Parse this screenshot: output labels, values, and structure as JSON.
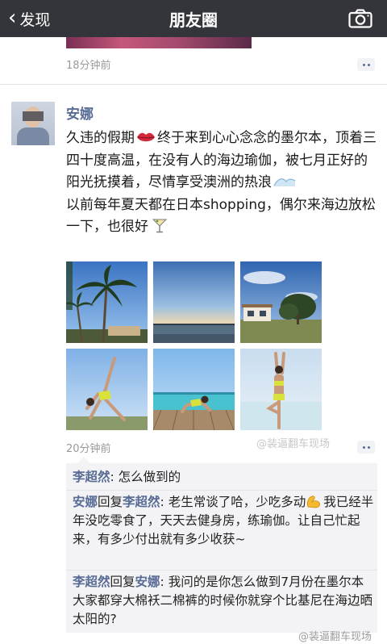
{
  "nav": {
    "back_label": "发现",
    "title": "朋友圈"
  },
  "previous_post": {
    "time": "18分钟前"
  },
  "post": {
    "author": "安娜",
    "line1_a": "久违的假期",
    "line1_b": "终于来到心心念念的墨尔本，顶着三四十度高温，在没有人的海边瑜伽，被七月正好的阳光抚摸着，尽情享受澳洲的热浪",
    "line2": "以前每年夏天都在日本shopping，偶尔来海边放松一下，也很好",
    "time": "20分钟前",
    "photos": [
      "beach-palm-trees",
      "sunset-sea",
      "coastal-house",
      "yoga-pose-grass",
      "yoga-on-pier",
      "tree-pose-sea"
    ]
  },
  "watermarks": {
    "middle": "@装逼翻车现场",
    "bottom": "@装逼翻车现场"
  },
  "comments": [
    {
      "author": "李超然",
      "reply_word": "",
      "reply_to": "",
      "text": "怎么做到的"
    },
    {
      "author": "安娜",
      "reply_word": "回复",
      "reply_to": "李超然",
      "text_a": "老生常谈了哈，少吃多动",
      "text_b": "我已经半年没吃零食了，天天去健身房，练瑜伽。让自己忙起来，有多少付出就有多少收获~"
    },
    {
      "author": "李超然",
      "reply_word": "回复",
      "reply_to": "安娜",
      "text": "我问的是你怎么做到7月份在墨尔本大家都穿大棉袄二棉裤的时候你就穿个比基尼在海边晒太阳的?"
    }
  ]
}
